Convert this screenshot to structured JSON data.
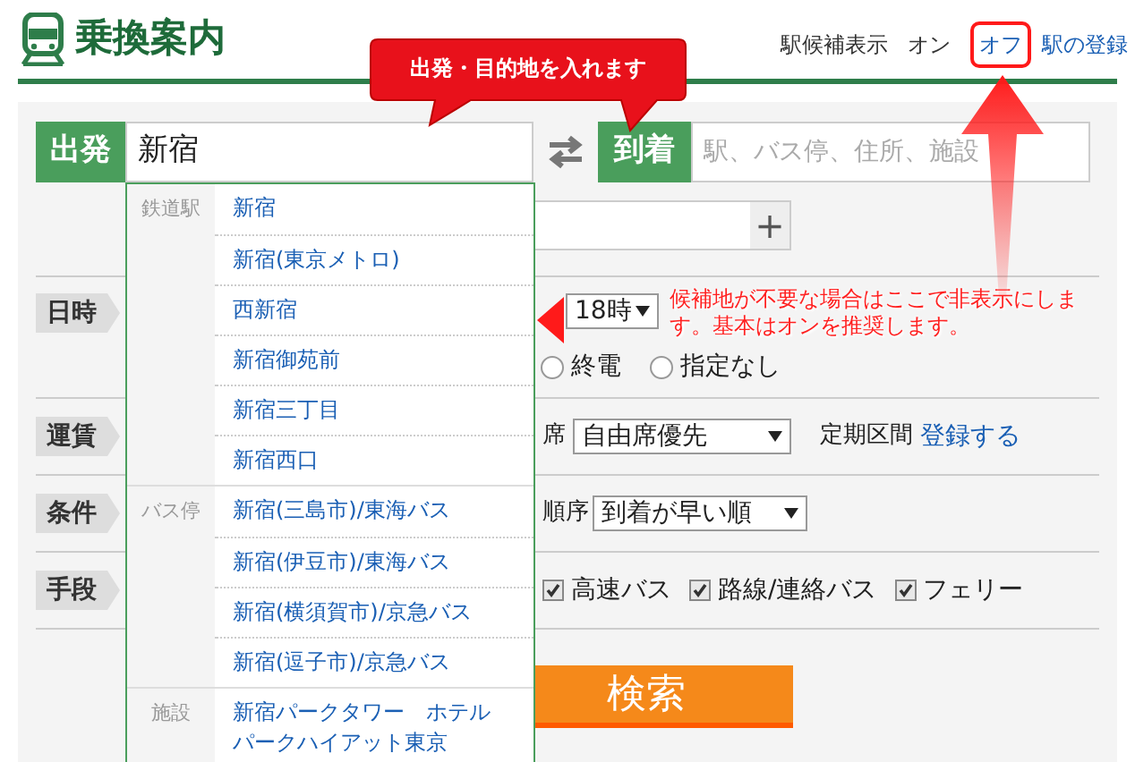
{
  "header": {
    "title": "乗換案内",
    "station_hint_label": "駅候補表示",
    "options": [
      {
        "label": "オン",
        "selected": true
      },
      {
        "label": "オフ",
        "selected": false
      }
    ],
    "register_link": "駅の登録"
  },
  "callouts": [
    {
      "kind": "bubble",
      "text": "出発・目的地を入れます"
    },
    {
      "kind": "note",
      "text": "候補地が不要な場合はここで非表示にします。基本はオンを推奨します。"
    }
  ],
  "route": {
    "from_label": "出発",
    "from_value": "新宿",
    "to_label": "到着",
    "to_placeholder": "駅、バス停、住所、施設"
  },
  "via": {
    "add_button": "+"
  },
  "datetime": {
    "label": "日時",
    "hour": "18時",
    "radios": [
      {
        "label": "終電",
        "selected": false
      },
      {
        "label": "指定なし",
        "selected": false
      }
    ]
  },
  "fare": {
    "label": "運賃",
    "seat_label": "席",
    "seat_value": "自由席優先",
    "commuter_label": "定期区間",
    "commuter_link": "登録する"
  },
  "conditions": {
    "label": "条件",
    "order_label": "順序",
    "order_value": "到着が早い順"
  },
  "means": {
    "label": "手段",
    "options": [
      {
        "label": "高速バス",
        "checked": true
      },
      {
        "label": "路線/連絡バス",
        "checked": true
      },
      {
        "label": "フェリー",
        "checked": true
      }
    ]
  },
  "search_button": "検索",
  "suggestions": [
    {
      "category": "鉄道駅",
      "items": [
        "新宿",
        "新宿(東京メトロ)",
        "西新宿",
        "新宿御苑前",
        "新宿三丁目",
        "新宿西口"
      ]
    },
    {
      "category": "バス停",
      "items": [
        "新宿(三島市)/東海バス",
        "新宿(伊豆市)/東海バス",
        "新宿(横須賀市)/京急バス",
        "新宿(逗子市)/京急バス"
      ]
    },
    {
      "category": "施設",
      "items": [
        "新宿パークタワー　ホテルパークハイアット東京"
      ]
    }
  ]
}
